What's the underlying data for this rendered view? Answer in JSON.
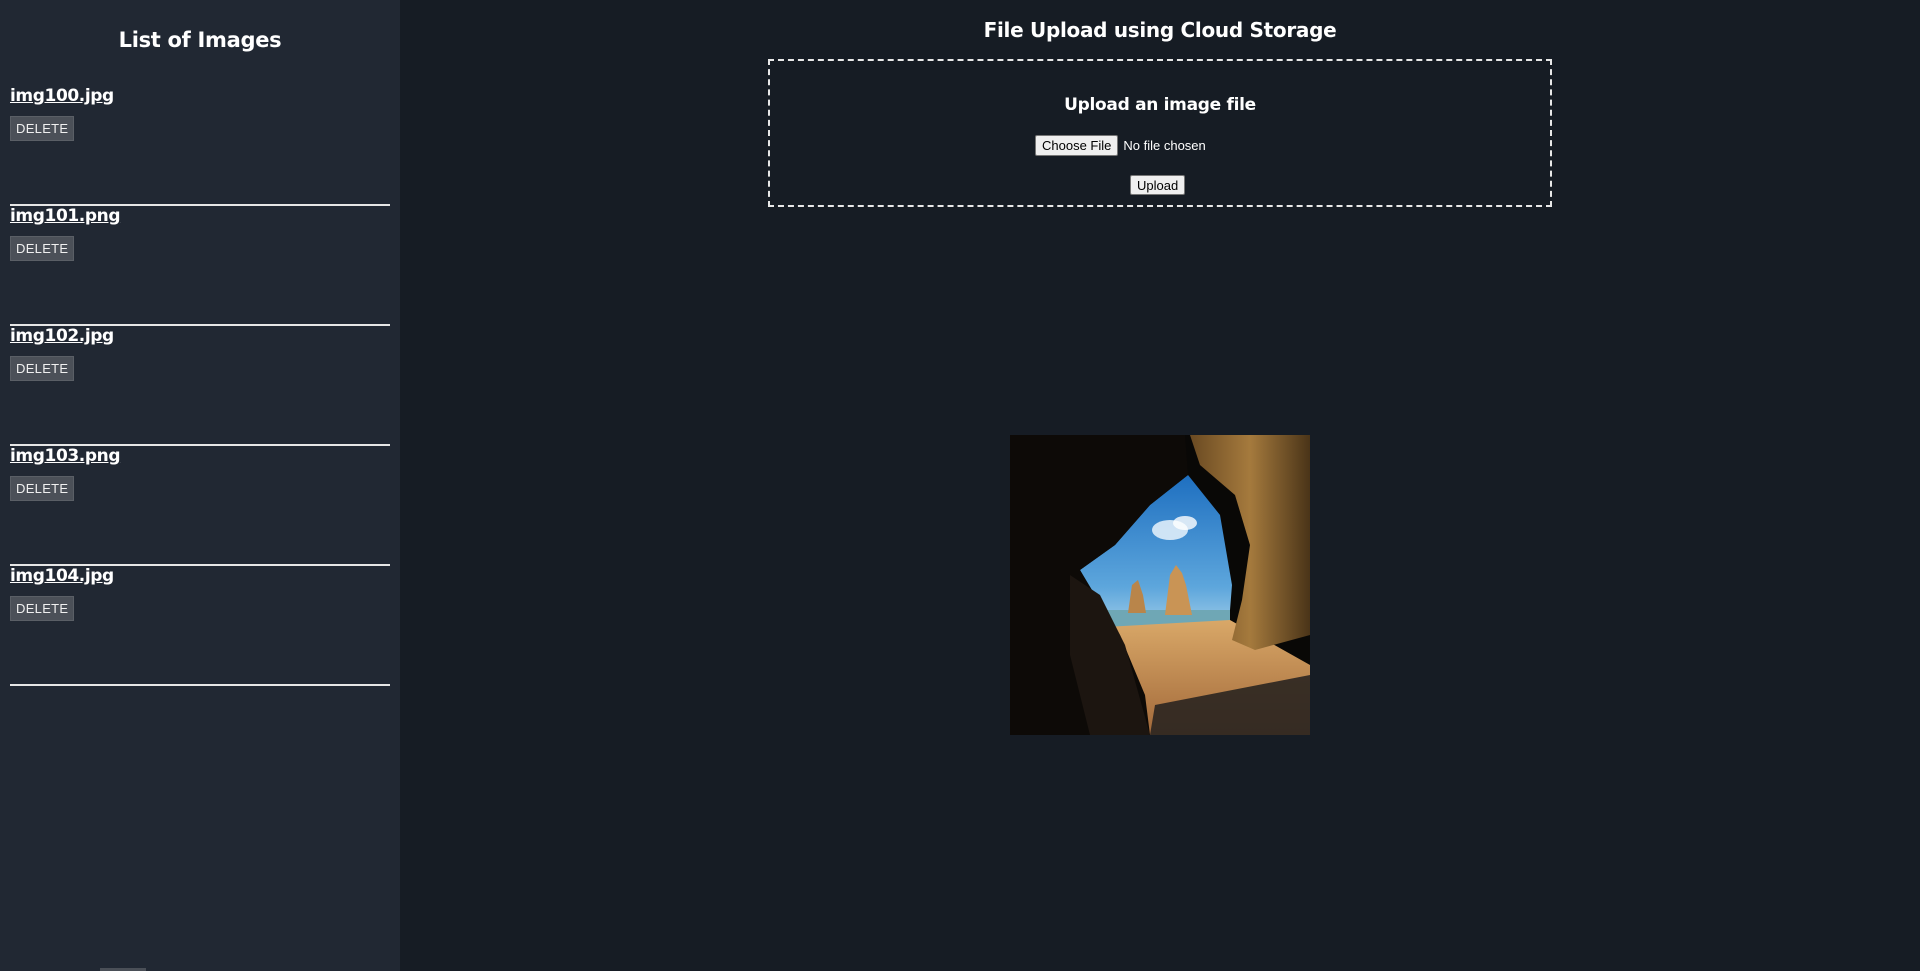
{
  "sidebar": {
    "title": "List of Images",
    "items": [
      {
        "name": "img100.jpg",
        "delete_label": "DELETE"
      },
      {
        "name": "img101.png",
        "delete_label": "DELETE"
      },
      {
        "name": "img102.jpg",
        "delete_label": "DELETE"
      },
      {
        "name": "img103.png",
        "delete_label": "DELETE"
      },
      {
        "name": "img104.jpg",
        "delete_label": "DELETE"
      }
    ]
  },
  "main": {
    "title": "File Upload using Cloud Storage",
    "upload": {
      "heading": "Upload an image file",
      "choose_file_label": "Choose File",
      "file_status": "No file chosen",
      "upload_label": "Upload"
    },
    "preview": {
      "alt": "Sea cave opening onto a sunny beach with rock stacks"
    }
  },
  "colors": {
    "page_background": "#161c24",
    "sidebar_background": "#212833",
    "delete_button": "#4b5058",
    "divider": "#e6e6e6"
  }
}
